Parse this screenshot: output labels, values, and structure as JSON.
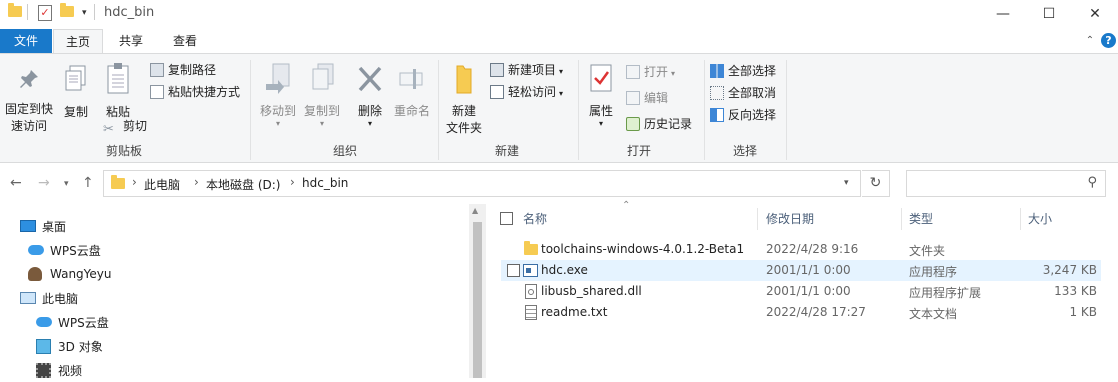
{
  "window": {
    "title": "hdc_bin",
    "minimize": "—",
    "maximize": "☐",
    "close": "✕"
  },
  "tabs": {
    "file": "文件",
    "home": "主页",
    "share": "共享",
    "view": "查看"
  },
  "ribbon": {
    "clipboard": {
      "pin": "固定到快\n速访问",
      "copy": "复制",
      "paste": "粘贴",
      "copy_path": "复制路径",
      "paste_shortcut": "粘贴快捷方式",
      "cut": "剪切",
      "label": "剪贴板"
    },
    "organize": {
      "move_to": "移动到",
      "copy_to": "复制到",
      "delete": "删除",
      "rename": "重命名",
      "label": "组织"
    },
    "new": {
      "new_folder": "新建\n文件夹",
      "new_item": "新建项目",
      "easy_access": "轻松访问",
      "label": "新建"
    },
    "open": {
      "properties": "属性",
      "open": "打开",
      "edit": "编辑",
      "history": "历史记录",
      "label": "打开"
    },
    "select": {
      "select_all": "全部选择",
      "select_none": "全部取消",
      "invert": "反向选择",
      "label": "选择"
    }
  },
  "address": {
    "crumbs": [
      "此电脑",
      "本地磁盘 (D:)",
      "hdc_bin"
    ],
    "search_placeholder": ""
  },
  "nav": [
    {
      "label": "桌面",
      "icon": "desktop-icon"
    },
    {
      "label": "WPS云盘",
      "icon": "cloud-icon"
    },
    {
      "label": "WangYeyu",
      "icon": "user-icon"
    },
    {
      "label": "此电脑",
      "icon": "computer-icon"
    },
    {
      "label": "WPS云盘",
      "icon": "cloud-icon"
    },
    {
      "label": "3D 对象",
      "icon": "cube-icon"
    },
    {
      "label": "视频",
      "icon": "video-icon"
    }
  ],
  "columns": {
    "name": "名称",
    "modified": "修改日期",
    "type": "类型",
    "size": "大小"
  },
  "files": [
    {
      "name": "toolchains-windows-4.0.1.2-Beta1",
      "modified": "2022/4/28 9:16",
      "type": "文件夹",
      "size": "",
      "icon": "folder-icon"
    },
    {
      "name": "hdc.exe",
      "modified": "2001/1/1 0:00",
      "type": "应用程序",
      "size": "3,247 KB",
      "icon": "exe-icon"
    },
    {
      "name": "libusb_shared.dll",
      "modified": "2001/1/1 0:00",
      "type": "应用程序扩展",
      "size": "133 KB",
      "icon": "dll-icon"
    },
    {
      "name": "readme.txt",
      "modified": "2022/4/28 17:27",
      "type": "文本文档",
      "size": "1 KB",
      "icon": "text-file-icon"
    }
  ]
}
